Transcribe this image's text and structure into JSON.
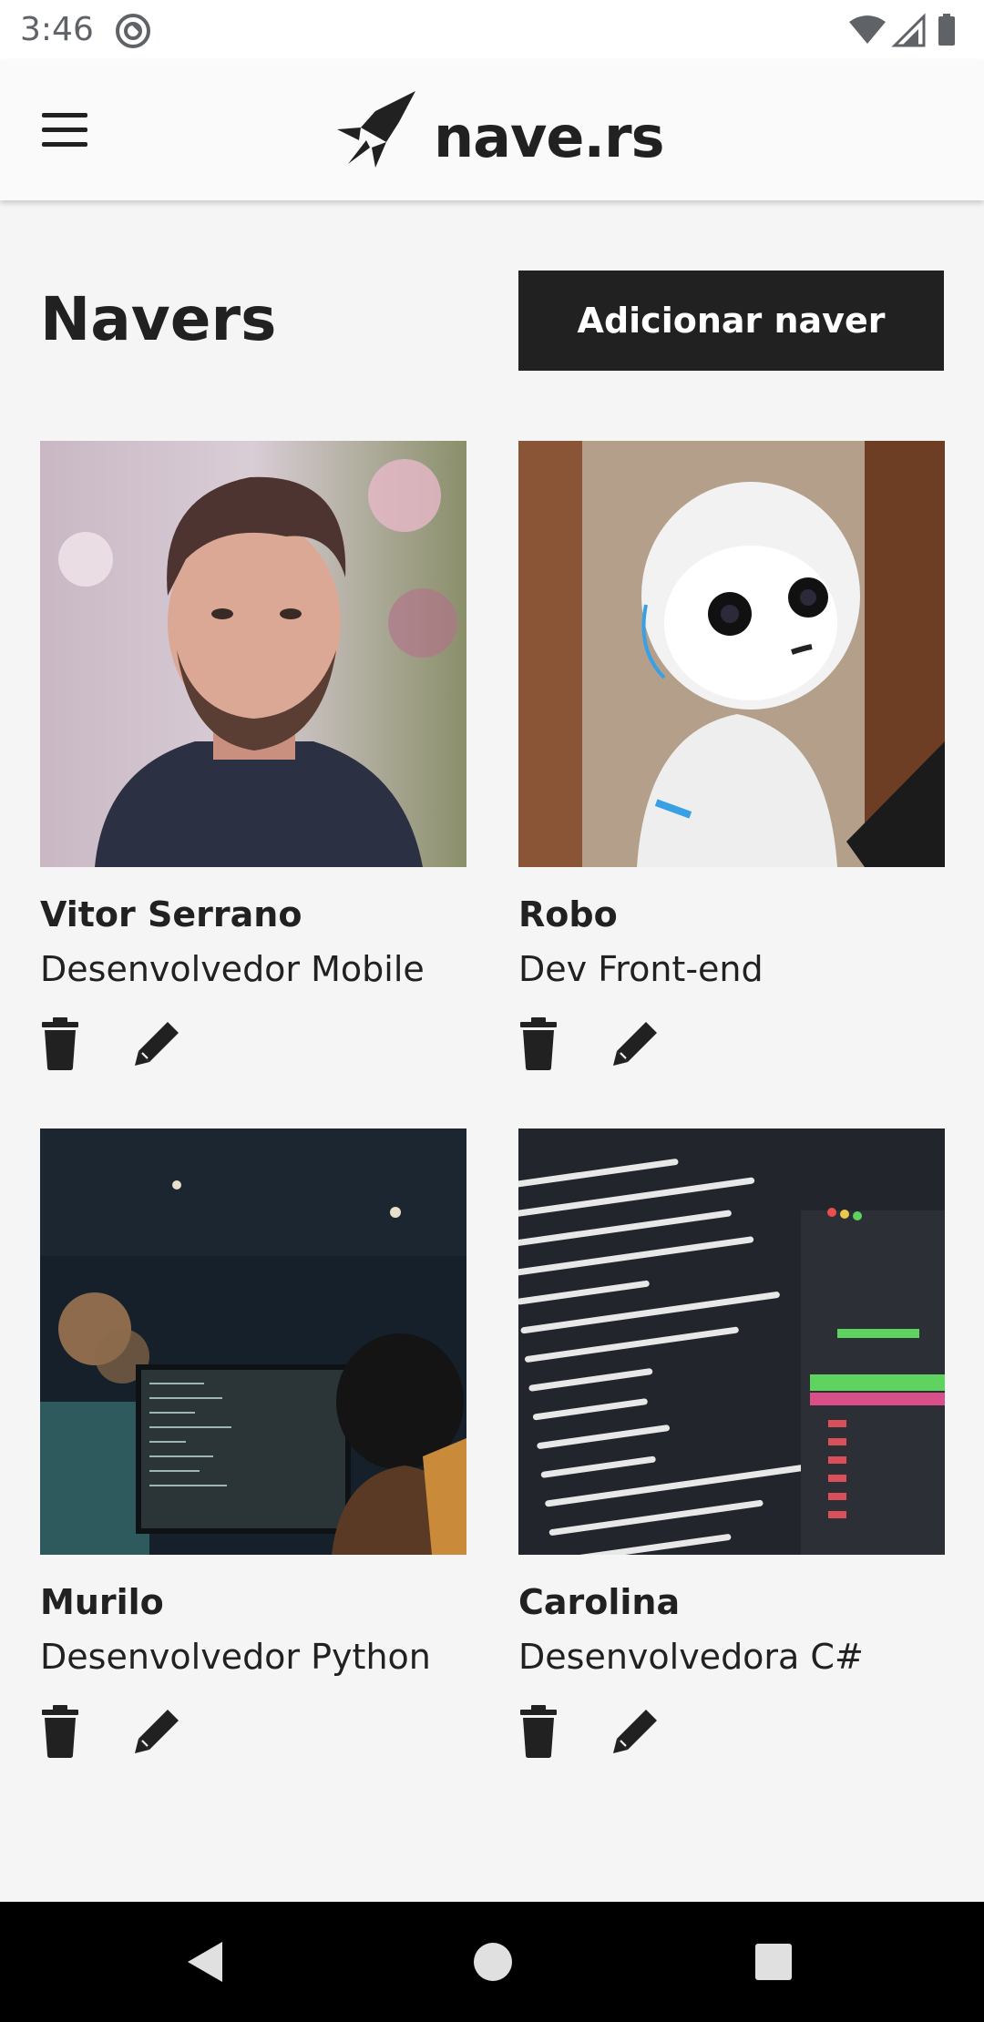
{
  "status_bar": {
    "time": "3:46",
    "app_icon": "sync-circle-icon",
    "icons": [
      "wifi-icon",
      "cell-signal-icon",
      "battery-icon"
    ]
  },
  "header": {
    "menu_icon": "hamburger-menu-icon",
    "logo_icon": "rocket-icon",
    "logo_text": "nave.rs"
  },
  "page": {
    "title": "Navers",
    "add_button_label": "Adicionar naver"
  },
  "navers": [
    {
      "name": "Vitor Serrano",
      "role": "Desenvolvedor Mobile",
      "photo": "portrait-photo"
    },
    {
      "name": "Robo",
      "role": "Dev Front-end",
      "photo": "robot-photo"
    },
    {
      "name": "Murilo",
      "role": "Desenvolvedor Python",
      "photo": "office-monitor-photo"
    },
    {
      "name": "Carolina",
      "role": "Desenvolvedora C#",
      "photo": "terminal-screen-photo"
    }
  ],
  "card_actions": {
    "delete_icon": "trash-icon",
    "edit_icon": "pencil-icon"
  },
  "nav_bar": {
    "back_icon": "back-triangle-icon",
    "home_icon": "home-circle-icon",
    "recents_icon": "recents-square-icon"
  },
  "colors": {
    "primary": "#212121",
    "background": "#f5f5f5",
    "header": "#fafafa",
    "button_text": "#ffffff"
  }
}
